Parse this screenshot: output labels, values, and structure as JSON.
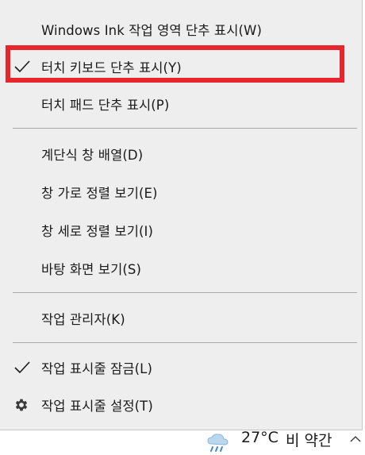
{
  "context_menu": {
    "items": [
      {
        "label": "Windows Ink 작업 영역 단추 표시(W)",
        "checked": false,
        "icon": null
      },
      {
        "label": "터치 키보드 단추 표시(Y)",
        "checked": true,
        "icon": "checkmark-icon",
        "highlighted": true
      },
      {
        "label": "터치 패드 단추 표시(P)",
        "checked": false,
        "icon": null
      },
      {
        "label": "계단식 창 배열(D)",
        "checked": false,
        "icon": null
      },
      {
        "label": "창 가로 정렬 보기(E)",
        "checked": false,
        "icon": null
      },
      {
        "label": "창 세로 정렬 보기(I)",
        "checked": false,
        "icon": null
      },
      {
        "label": "바탕 화면 보기(S)",
        "checked": false,
        "icon": null
      },
      {
        "label": "작업 관리자(K)",
        "checked": false,
        "icon": null
      },
      {
        "label": "작업 표시줄 잠금(L)",
        "checked": true,
        "icon": "checkmark-icon"
      },
      {
        "label": "작업 표시줄 설정(T)",
        "checked": false,
        "icon": "gear-icon"
      }
    ],
    "highlight_color": "#e8242c"
  },
  "taskbar": {
    "weather": {
      "icon": "rain-cloud-icon",
      "temperature": "27°C",
      "description": "비 약간"
    },
    "tray_icon": "chevron-up-icon"
  }
}
